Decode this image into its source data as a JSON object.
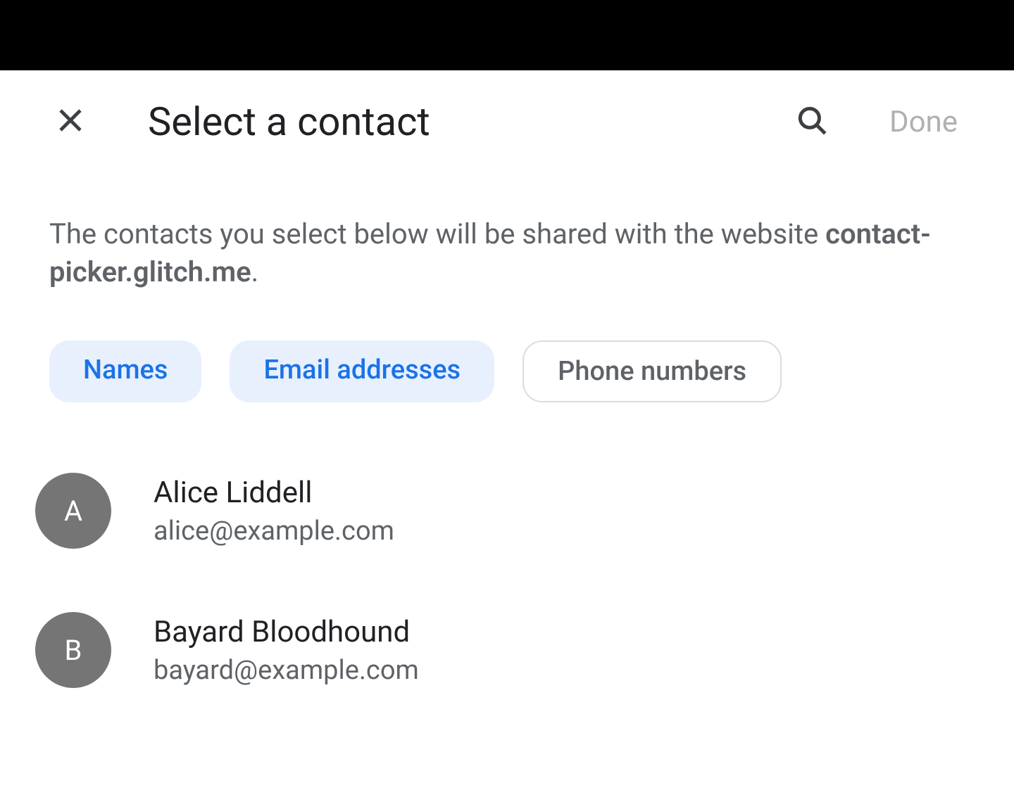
{
  "header": {
    "title": "Select a contact",
    "done_label": "Done"
  },
  "description": {
    "prefix": "The contacts you select below will be shared with the website ",
    "site": "contact-picker.glitch.me",
    "suffix": "."
  },
  "chips": [
    {
      "label": "Names",
      "selected": true
    },
    {
      "label": "Email addresses",
      "selected": true
    },
    {
      "label": "Phone numbers",
      "selected": false
    }
  ],
  "contacts": [
    {
      "initial": "A",
      "name": "Alice Liddell",
      "email": "alice@example.com"
    },
    {
      "initial": "B",
      "name": "Bayard Bloodhound",
      "email": "bayard@example.com"
    }
  ],
  "colors": {
    "accent": "#1a73e8",
    "chip_bg": "#e8f0fe",
    "text_primary": "#202124",
    "text_secondary": "#5f6368",
    "avatar_bg": "#757575"
  }
}
